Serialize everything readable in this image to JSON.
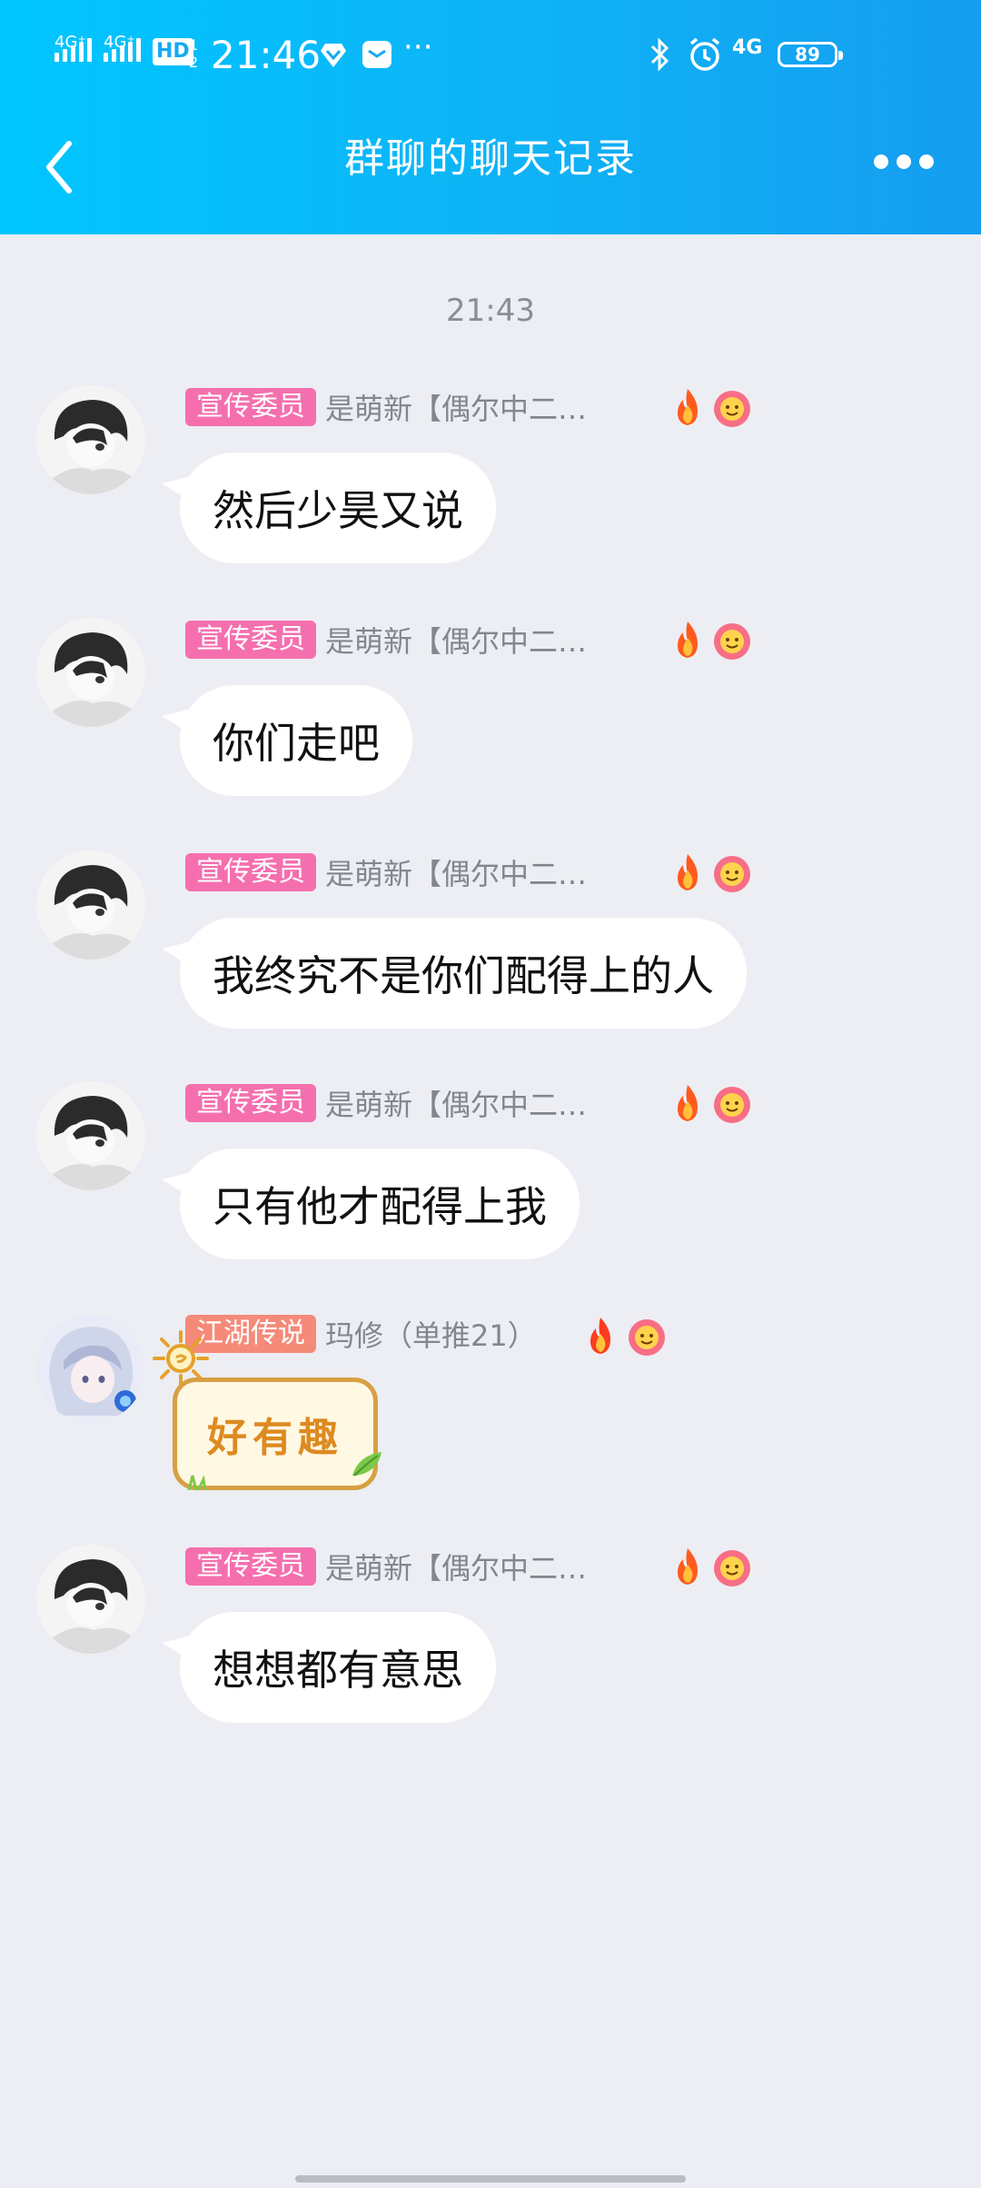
{
  "status_bar": {
    "net1": "4G⁺",
    "net2": "4G⁺",
    "hd": "HD",
    "time": "21:46",
    "dots": "···",
    "net3": "4G",
    "battery": "89"
  },
  "header": {
    "title": "群聊的聊天记录"
  },
  "chat": {
    "timestamp": "21:43",
    "messages": [
      {
        "badge": "宣传委员",
        "nick": "是萌新【偶尔中二…",
        "text": "然后少昊又说"
      },
      {
        "badge": "宣传委员",
        "nick": "是萌新【偶尔中二…",
        "text": "你们走吧"
      },
      {
        "badge": "宣传委员",
        "nick": "是萌新【偶尔中二…",
        "text": "我终究不是你们配得上的人"
      },
      {
        "badge": "宣传委员",
        "nick": "是萌新【偶尔中二…",
        "text": "只有他才配得上我"
      },
      {
        "badge": "江湖传说",
        "nick": "玛修（单推21）",
        "sticker_text": "好有趣"
      },
      {
        "badge": "宣传委员",
        "nick": "是萌新【偶尔中二…",
        "text": "想想都有意思"
      }
    ]
  },
  "colors": {
    "header_start": "#00c6ff",
    "header_end": "#159df0",
    "badge_pink": "#f56fae",
    "badge_orange": "#f58a78",
    "background": "#edeef3"
  }
}
